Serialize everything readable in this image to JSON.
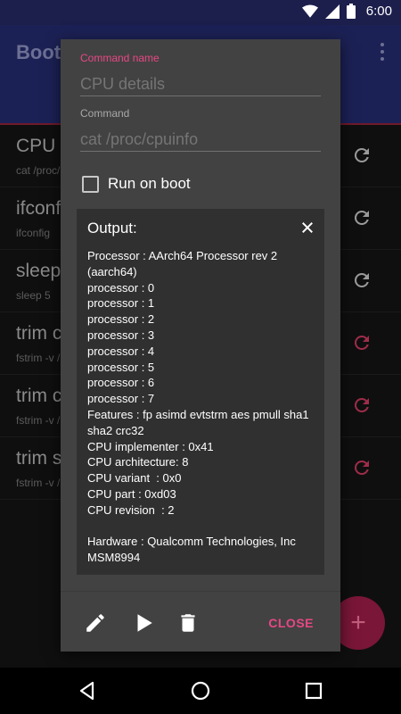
{
  "status_bar": {
    "time": "6:00",
    "icons": [
      "wifi-icon",
      "signal-icon",
      "battery-icon"
    ]
  },
  "app_bar": {
    "title": "Boot",
    "menu_icon": "overflow-menu-icon"
  },
  "list": {
    "items": [
      {
        "title": "CPU d",
        "subtitle": "cat /proc/",
        "action_icon": "refresh-icon",
        "action_color": "#9a9a9a"
      },
      {
        "title": "ifconf",
        "subtitle": "ifconfig",
        "action_icon": "refresh-icon",
        "action_color": "#9a9a9a"
      },
      {
        "title": "sleep",
        "subtitle": "sleep 5",
        "action_icon": "refresh-icon",
        "action_color": "#9a9a9a"
      },
      {
        "title": "trim c",
        "subtitle": "fstrim -v /",
        "action_icon": "refresh-icon",
        "action_color": "#9e2d4a"
      },
      {
        "title": "trim c",
        "subtitle": "fstrim -v /",
        "action_icon": "refresh-icon",
        "action_color": "#9e2d4a"
      },
      {
        "title": "trim s",
        "subtitle": "fstrim -v /",
        "action_icon": "refresh-icon",
        "action_color": "#9e2d4a"
      }
    ]
  },
  "fab": {
    "label": "+"
  },
  "dialog": {
    "command_name_label": "Command name",
    "command_name_value": "CPU details",
    "command_label": "Command",
    "command_value": "cat /proc/cpuinfo",
    "run_on_boot_label": "Run on boot",
    "run_on_boot_checked": false,
    "output_title": "Output:",
    "output_text": "Processor : AArch64 Processor rev 2 (aarch64)\nprocessor : 0\nprocessor : 1\nprocessor : 2\nprocessor : 3\nprocessor : 4\nprocessor : 5\nprocessor : 6\nprocessor : 7\nFeatures : fp asimd evtstrm aes pmull sha1 sha2 crc32\nCPU implementer : 0x41\nCPU architecture: 8\nCPU variant  : 0x0\nCPU part : 0xd03\nCPU revision  : 2\n\nHardware : Qualcomm Technologies, Inc MSM8994",
    "close_label": "CLOSE",
    "accent_color": "#e84784"
  },
  "nav_bar": {
    "icons": [
      "back-icon",
      "home-icon",
      "recents-icon"
    ]
  }
}
